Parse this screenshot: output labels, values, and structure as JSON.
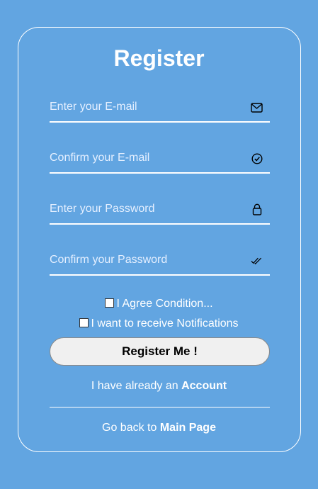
{
  "form": {
    "title": "Register",
    "fields": [
      {
        "placeholder": "Enter your E-mail",
        "value": "",
        "icon": "envelope-icon"
      },
      {
        "placeholder": "Confirm your E-mail",
        "value": "",
        "icon": "check-circle-icon"
      },
      {
        "placeholder": "Enter your Password",
        "value": "",
        "icon": "lock-icon"
      },
      {
        "placeholder": "Confirm your Password",
        "value": "",
        "icon": "double-check-icon"
      }
    ],
    "checkboxes": [
      {
        "label": "I Agree Condition...",
        "checked": false
      },
      {
        "label": "I want to receive Notifications",
        "checked": false
      }
    ],
    "submit_label": "Register Me !",
    "account_prefix": "I have already an ",
    "account_link": "Account",
    "back_prefix": "Go back to ",
    "back_link": "Main Page"
  },
  "colors": {
    "background": "#62a5e1",
    "foreground": "#ffffff",
    "button_bg": "#f0f0f0"
  }
}
